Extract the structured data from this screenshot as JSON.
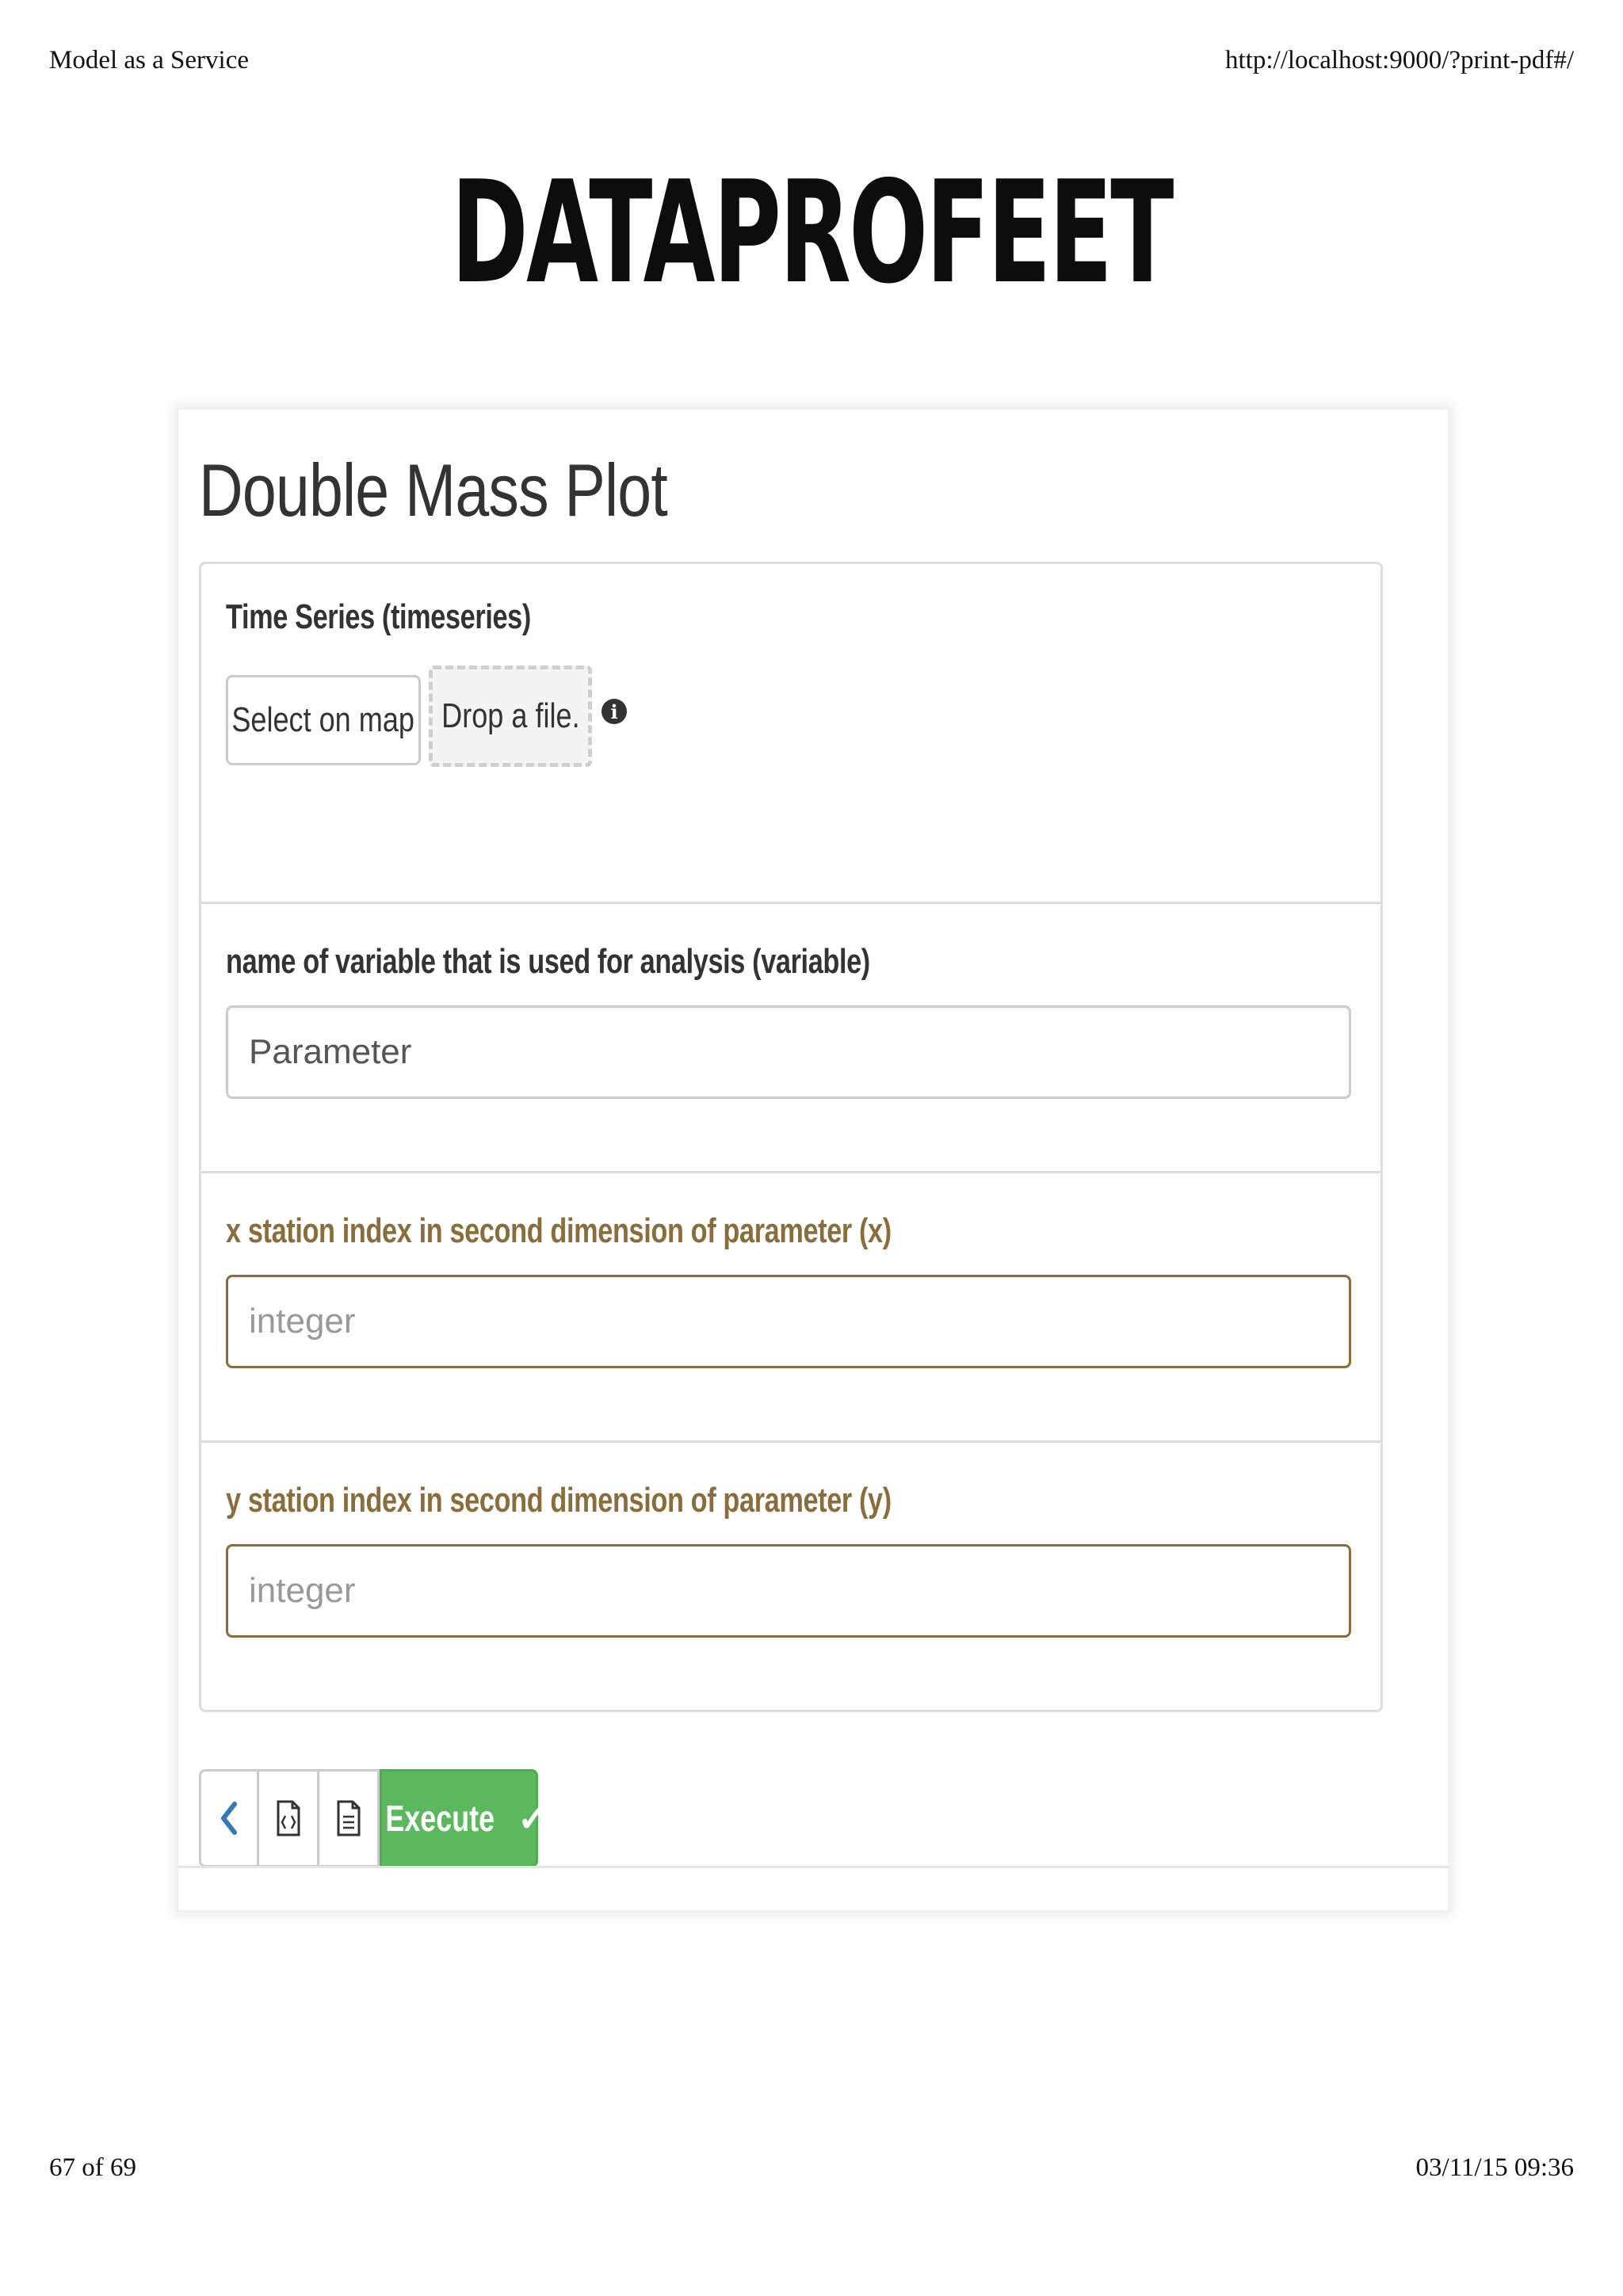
{
  "print_header": {
    "left_text": "Model as a Service",
    "right_text": "http://localhost:9000/?print-pdf#/"
  },
  "brand": "DATAPROFEET",
  "form": {
    "title": "Double Mass Plot",
    "timeseries": {
      "label": "Time Series (timeseries)",
      "select_button": "Select on map",
      "drop_text": "Drop a file.",
      "info_icon": "i"
    },
    "variable": {
      "label": "name of variable that is used for analysis (variable)",
      "value": "Parameter"
    },
    "x_field": {
      "label": "x station index in second dimension of parameter (x)",
      "placeholder": "integer"
    },
    "y_field": {
      "label": "y station index in second dimension of parameter (y)",
      "placeholder": "integer"
    }
  },
  "toolbar": {
    "execute_label": "Execute",
    "execute_icon": "✓",
    "back_icon": "chevron-left-icon",
    "code_icon": "code-file-icon",
    "doc_icon": "document-icon"
  },
  "colors": {
    "success": "#5cb85c",
    "warning_text": "#8a6d3b",
    "border": "#cccccc"
  },
  "print_footer": {
    "page": "67 of 69",
    "datetime": "03/11/15 09:36"
  }
}
